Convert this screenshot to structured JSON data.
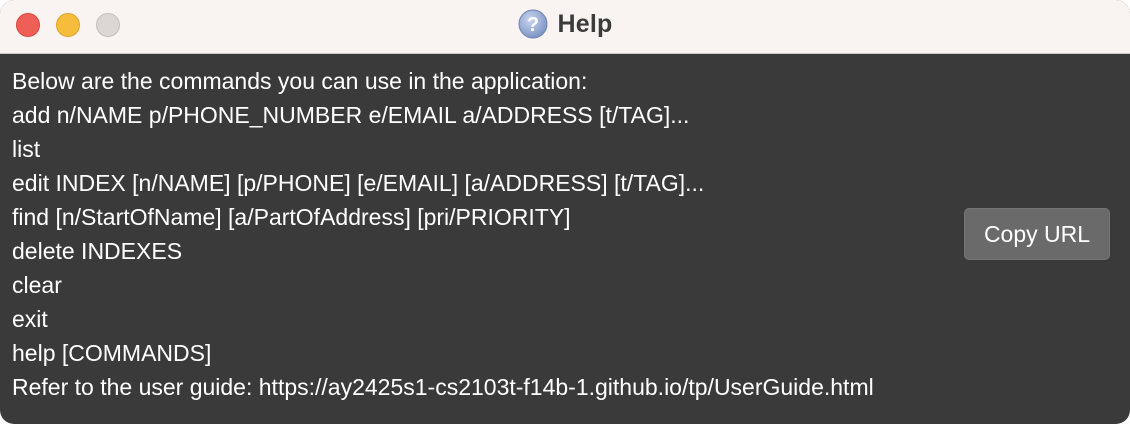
{
  "window": {
    "title": "Help",
    "icon": "question-mark-circle-icon",
    "controls": [
      "close",
      "minimize",
      "zoom"
    ]
  },
  "content": {
    "lines": [
      "Below are the commands you can use in the application:",
      "add n/NAME p/PHONE_NUMBER e/EMAIL a/ADDRESS [t/TAG]...",
      "list",
      "edit INDEX [n/NAME] [p/PHONE] [e/EMAIL] [a/ADDRESS] [t/TAG]...",
      "find [n/StartOfName] [a/PartOfAddress] [pri/PRIORITY]",
      "delete INDEXES",
      "clear",
      "exit",
      "help [COMMANDS]",
      "Refer to the user guide: https://ay2425s1-cs2103t-f14b-1.github.io/tp/UserGuide.html"
    ]
  },
  "actions": {
    "copy_url_label": "Copy URL"
  },
  "colors": {
    "background": "#3a3a3a",
    "titlebar": "#f9f3f1",
    "text": "#ffffff",
    "button": "#6a6a6a",
    "close": "#ee5f57",
    "minimize": "#f6bd3c",
    "zoom": "#dcd7d5"
  }
}
